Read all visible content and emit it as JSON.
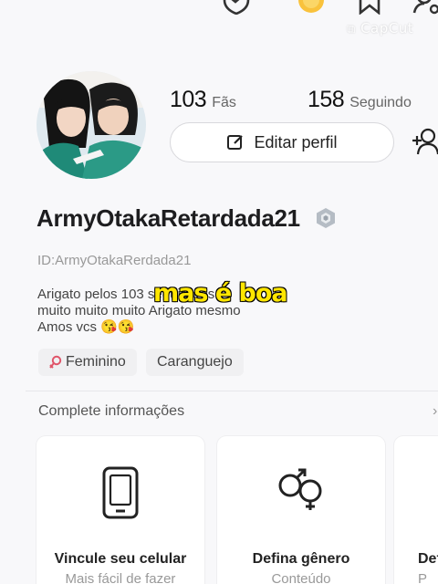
{
  "watermark": "CapCut",
  "profile": {
    "fans_count": "103",
    "fans_label": "Fãs",
    "following_count": "158",
    "following_label": "Seguindo",
    "edit_button_label": "Editar perfil",
    "username": "ArmyOtakaRetardada21",
    "user_id": "ID:ArmyOtakaRerdada21",
    "bio_lines": [
      "Arigato pelos 103 seguidores",
      "muito muito muito Arigato mesmo",
      "Amos vcs 😘😘"
    ],
    "tags": [
      "Feminino",
      "Caranguejo"
    ]
  },
  "video_caption": "mas é boa",
  "complete_info": {
    "title": "Complete informações",
    "arrow": "›",
    "cards": [
      {
        "title": "Vincule seu celular",
        "subtitle": "Mais fácil de fazer",
        "icon": "phone-icon"
      },
      {
        "title": "Defina gênero",
        "subtitle": "Conteúdo",
        "icon": "gender-icon"
      },
      {
        "title": "Def",
        "subtitle": "P",
        "icon": "unknown"
      }
    ]
  },
  "colors": {
    "accent_caption": "#ffe600",
    "gender_icon": "#e0556a",
    "avatar_bg": "#6ab7c9"
  }
}
